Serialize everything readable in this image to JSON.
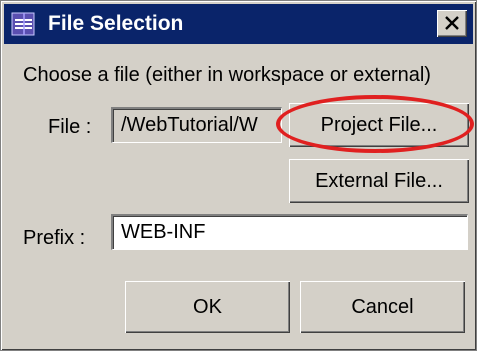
{
  "window": {
    "title": "File Selection",
    "icon": "eclipse-icon",
    "close_icon": "close-icon"
  },
  "form": {
    "instruction": "Choose a file (either in workspace or external)",
    "file_label": "File :",
    "file_value": "/WebTutorial/W",
    "prefix_label": "Prefix :",
    "prefix_value": "WEB-INF"
  },
  "buttons": {
    "project_file": "Project File...",
    "external_file": "External File...",
    "ok": "OK",
    "cancel": "Cancel"
  },
  "annotation": {
    "highlight_color": "#e02020",
    "highlight_target": "Project File..."
  }
}
